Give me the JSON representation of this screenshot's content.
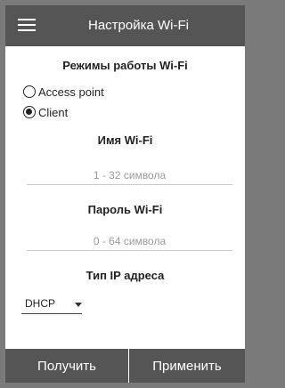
{
  "header": {
    "title": "Настройка Wi-Fi",
    "menu_icon": "hamburger-menu-icon"
  },
  "wifi_mode": {
    "title": "Режимы работы Wi-Fi",
    "options": [
      {
        "label": "Access point",
        "checked": false
      },
      {
        "label": "Client",
        "checked": true
      }
    ]
  },
  "ssid": {
    "title": "Имя Wi-Fi",
    "value": "",
    "placeholder": "1 - 32 символа"
  },
  "password": {
    "title": "Пароль Wi-Fi",
    "value": "",
    "placeholder": "0 - 64 символа"
  },
  "ip_type": {
    "title": "Тип IP адреса",
    "selected": "DHCP"
  },
  "footer": {
    "get_label": "Получить",
    "apply_label": "Применить"
  },
  "colors": {
    "bar": "#555555",
    "background": "#ffffff",
    "frame": "#7a7a7a"
  }
}
